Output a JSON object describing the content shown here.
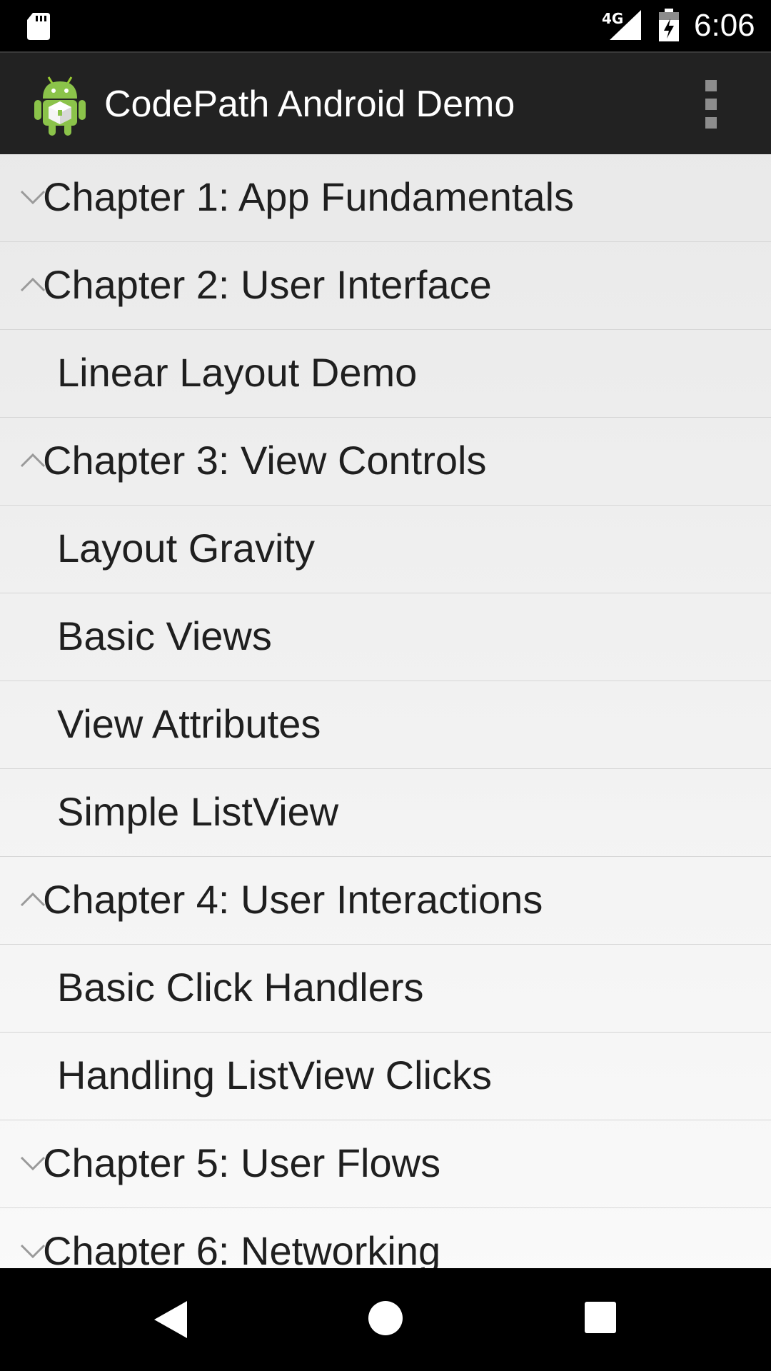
{
  "status_bar": {
    "time": "6:06",
    "network_type": "4G",
    "icons": [
      "sd-card-icon",
      "signal-icon",
      "battery-charging-icon"
    ]
  },
  "action_bar": {
    "title": "CodePath Android Demo",
    "icons": [
      "android-app-icon",
      "overflow-menu-icon"
    ]
  },
  "list": {
    "rows": [
      {
        "type": "group",
        "label": "Chapter 1: App Fundamentals",
        "expanded": false
      },
      {
        "type": "group",
        "label": "Chapter 2: User Interface",
        "expanded": true
      },
      {
        "type": "child",
        "label": "Linear Layout Demo"
      },
      {
        "type": "group",
        "label": "Chapter 3: View Controls",
        "expanded": true
      },
      {
        "type": "child",
        "label": "Layout Gravity"
      },
      {
        "type": "child",
        "label": "Basic Views"
      },
      {
        "type": "child",
        "label": "View Attributes"
      },
      {
        "type": "child",
        "label": "Simple ListView"
      },
      {
        "type": "group",
        "label": "Chapter 4: User Interactions",
        "expanded": true
      },
      {
        "type": "child",
        "label": "Basic Click Handlers"
      },
      {
        "type": "child",
        "label": "Handling ListView Clicks"
      },
      {
        "type": "group",
        "label": "Chapter 5: User Flows",
        "expanded": false
      },
      {
        "type": "group",
        "label": "Chapter 6: Networking",
        "expanded": false
      }
    ]
  },
  "nav_bar": {
    "icons": [
      "back-icon",
      "home-icon",
      "recents-icon"
    ]
  },
  "colors": {
    "status_bar_bg": "#000000",
    "action_bar_bg": "#222222",
    "list_text": "#1f1f1f",
    "divider": "#d6d6d6"
  }
}
